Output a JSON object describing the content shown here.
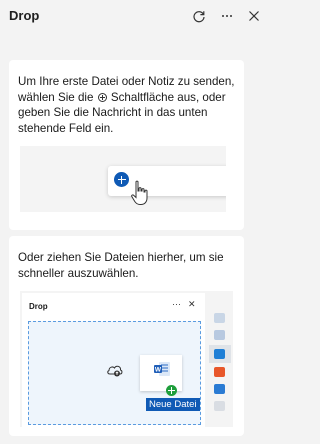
{
  "header": {
    "title": "Drop",
    "refresh_icon": "refresh-icon",
    "more_icon": "more-icon",
    "close_icon": "close-icon"
  },
  "card1": {
    "text_before": "Um Ihre erste Datei oder Notiz zu senden, wählen Sie die",
    "text_after": "Schaltfläche aus, oder geben Sie die Nachricht in das unten stehende Feld ein.",
    "inline_icon": "plus-circle-icon",
    "illustration": {
      "plus_icon": "plus-circle-icon",
      "hand_icon": "hand-pointer-icon"
    }
  },
  "card2": {
    "text": "Oder ziehen Sie Dateien hierher, um sie schneller auszuwählen.",
    "illustration": {
      "window_title": "Drop",
      "more_label": "···",
      "close_label": "✕",
      "file_label": "Neue Datei",
      "cloud_icon": "cloud-upload-icon",
      "doc_icon": "word-document-icon",
      "add_icon": "plus-circle-icon"
    }
  },
  "colors": {
    "accent": "#0f5ab5",
    "background": "#f3f3f3",
    "card": "#ffffff",
    "green": "#1e9e3b"
  }
}
